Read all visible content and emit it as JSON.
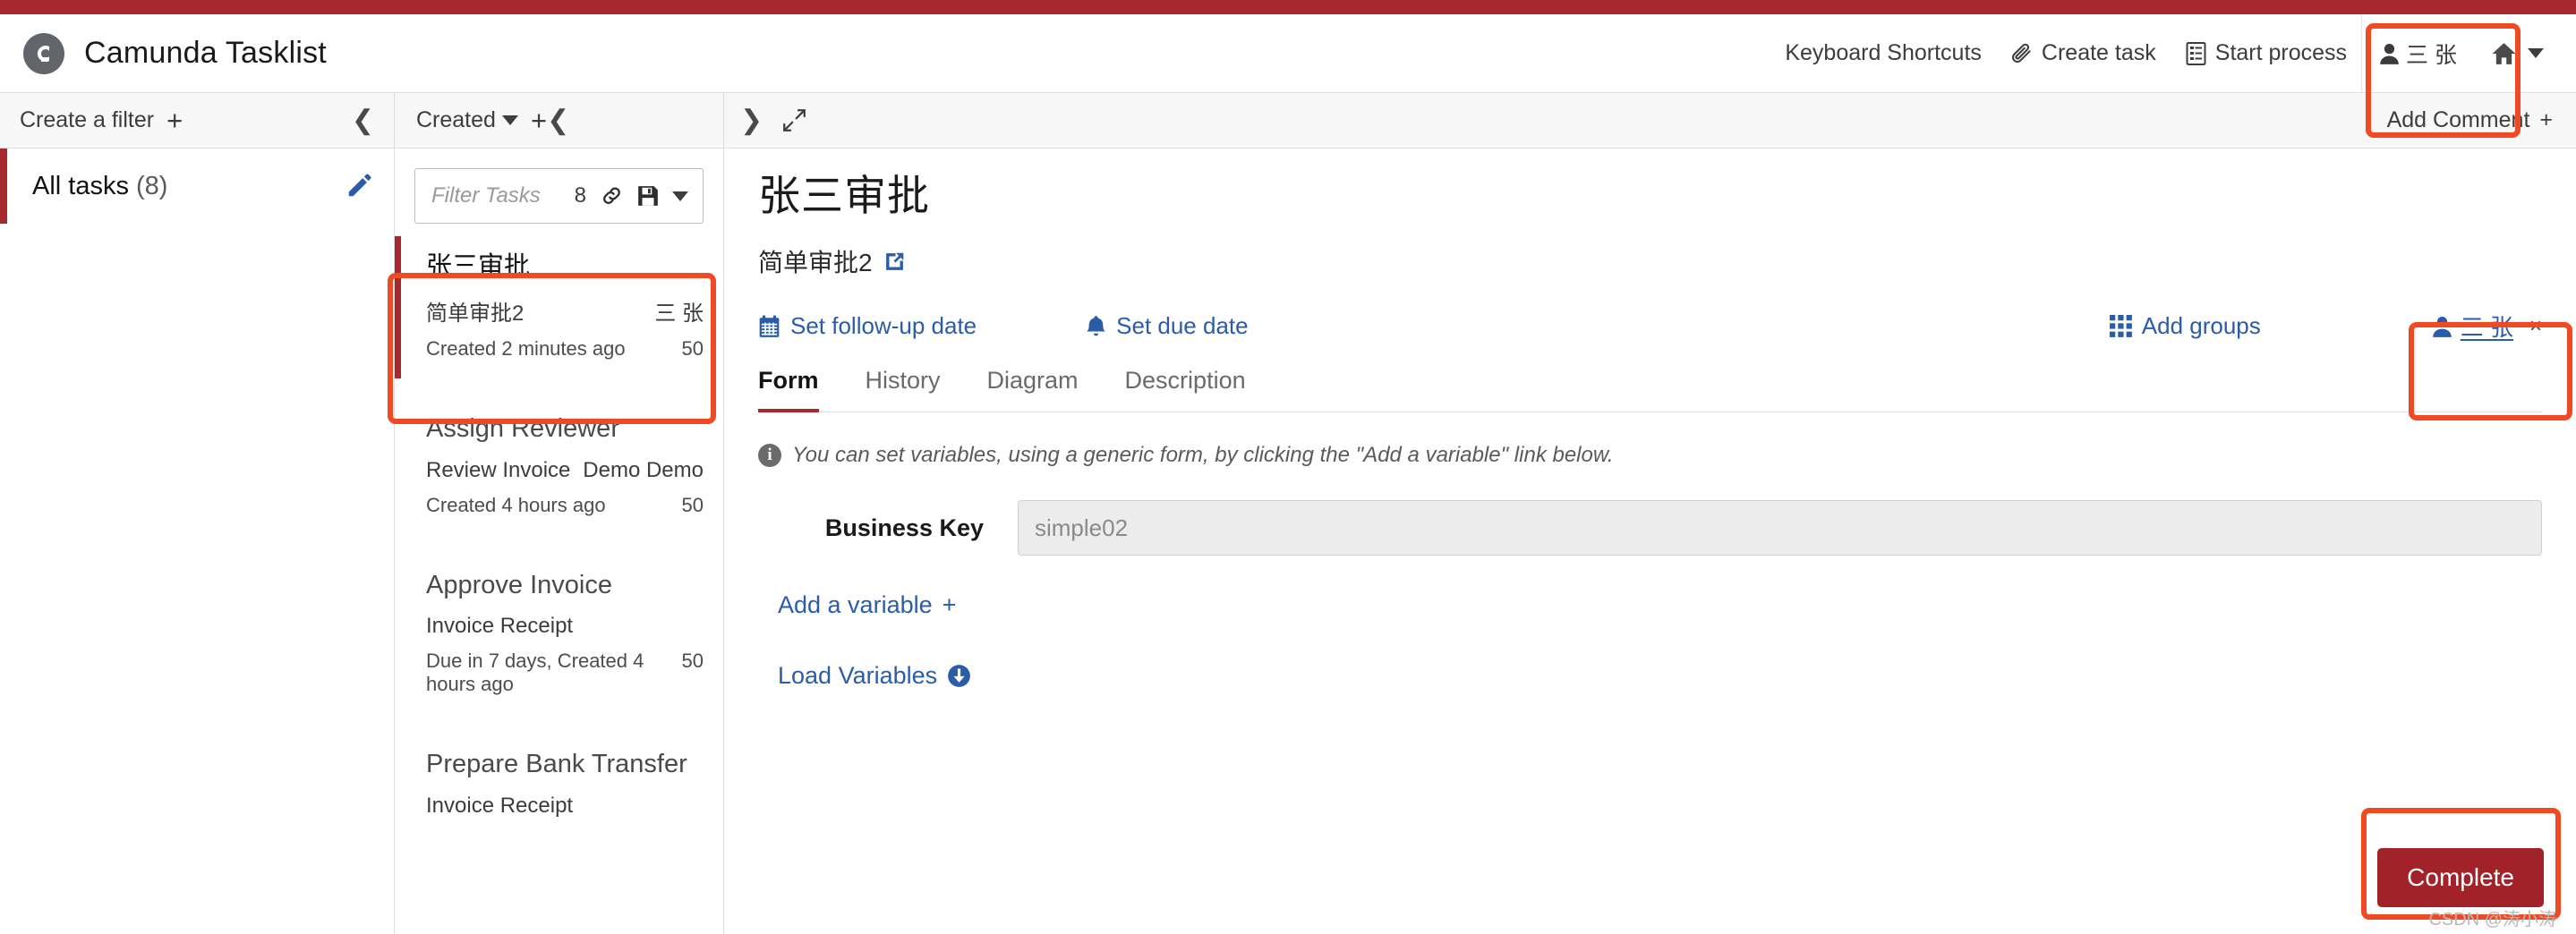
{
  "app": {
    "title": "Camunda Tasklist",
    "logo_letter": "C",
    "accent_red": "#a8282f",
    "link_blue": "#2a5caa",
    "annotation_color": "#f04a23"
  },
  "header": {
    "keyboard_shortcuts": "Keyboard Shortcuts",
    "create_task": "Create task",
    "start_process": "Start process",
    "user_name": "三 张",
    "icons": {
      "create_task": "paperclip-icon",
      "start_process": "list-document-icon",
      "user": "user-icon",
      "home": "home-icon",
      "home_caret": "caret-down-icon"
    }
  },
  "filters_panel": {
    "create_filter_label": "Create a filter",
    "create_filter_plus": "+",
    "collapse_icon": "chevron-left-icon",
    "items": [
      {
        "label": "All tasks",
        "count": "(8)",
        "edit_icon": "pencil-icon",
        "selected": true
      }
    ]
  },
  "tasks_panel": {
    "sort_label": "Created",
    "sort_caret": "caret-down-icon",
    "add_label": "+",
    "collapse_icon": "chevron-left-icon",
    "search": {
      "placeholder": "Filter Tasks",
      "value": "",
      "result_count": "8",
      "link_icon": "link-icon",
      "save_icon": "floppy-disk-icon",
      "save_caret": "caret-down-icon"
    },
    "tasks": [
      {
        "title": "张三审批",
        "process": "简单审批2",
        "assignee": "三 张",
        "meta": "Created 2 minutes ago",
        "priority": "50",
        "selected": true
      },
      {
        "title": "Assign Reviewer",
        "process": "Review Invoice",
        "assignee": "Demo Demo",
        "meta": "Created 4 hours ago",
        "priority": "50",
        "selected": false
      },
      {
        "title": "Approve Invoice",
        "process": "Invoice Receipt",
        "assignee": "",
        "meta": "Due in 7 days, Created 4 hours ago",
        "priority": "50",
        "selected": false
      },
      {
        "title": "Prepare Bank Transfer",
        "process": "Invoice Receipt",
        "assignee": "",
        "meta": "",
        "priority": "",
        "selected": false
      }
    ]
  },
  "detail": {
    "expand_icon": "chevron-right-icon",
    "fullscreen_icon": "expand-arrows-icon",
    "add_comment_label": "Add Comment",
    "add_comment_plus": "+",
    "task_title": "张三审批",
    "process_name": "简单审批2",
    "process_link_icon": "external-link-icon",
    "actions": {
      "set_follow_up": "Set follow-up date",
      "set_follow_up_icon": "calendar-icon",
      "set_due_date": "Set due date",
      "set_due_date_icon": "bell-icon",
      "add_groups": "Add groups",
      "add_groups_icon": "grid-icon",
      "assignee": "三 张",
      "assignee_icon": "user-icon",
      "assignee_remove": "×"
    },
    "tabs": [
      {
        "label": "Form",
        "active": true
      },
      {
        "label": "History",
        "active": false
      },
      {
        "label": "Diagram",
        "active": false
      },
      {
        "label": "Description",
        "active": false
      }
    ],
    "info_message": "You can set variables, using a generic form, by clicking the \"Add a variable\" link below.",
    "info_icon": "info-icon",
    "form": {
      "business_key_label": "Business Key",
      "business_key_value": "simple02"
    },
    "add_variable_label": "Add a variable",
    "add_variable_plus": "+",
    "load_variables_label": "Load Variables",
    "load_variables_icon": "download-circle-icon",
    "complete_button": "Complete"
  },
  "watermark": "CSDN @涛小涛"
}
